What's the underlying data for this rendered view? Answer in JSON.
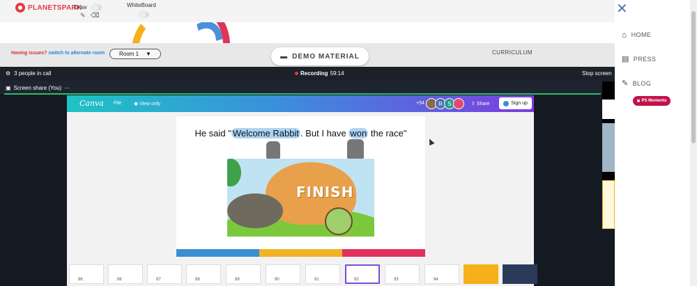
{
  "topbar": {
    "logo": "PLANETSPARK",
    "draw_label": "Draw",
    "whiteboard_label": "WhiteBoard"
  },
  "nav": {
    "close_icon": "close-icon",
    "items": [
      {
        "label": "HOME",
        "icon": "home-icon"
      },
      {
        "label": "PRESS",
        "icon": "press-icon"
      },
      {
        "label": "BLOG",
        "icon": "blog-icon"
      }
    ],
    "ps_badge": "PS Moments"
  },
  "issues": {
    "prefix": "Having issues?",
    "link": "switch to alternate room",
    "room": "Room 1"
  },
  "demo_material": "DEMO MATERIAL",
  "curriculum": "CURRICULUM",
  "call": {
    "people": "3 people in call",
    "recording_label": "Recording",
    "recording_time": "59:14",
    "stop_screen": "Stop screen",
    "share_tab": "Screen share (You)"
  },
  "canva": {
    "logo": "Canva",
    "file": "File",
    "view_only": "View only",
    "participants_count": "+54",
    "avatars": [
      "R",
      "S"
    ],
    "share": "Share",
    "signup": "Sign up",
    "slide": {
      "text_before": "He said \"",
      "highlight1": "Welcome Rabbit",
      "text_middle": ". But I have ",
      "highlight2": "won",
      "text_after": " the race\"",
      "image_caption": "FINISH"
    },
    "thumbnails": [
      "86",
      "86",
      "87",
      "88",
      "89",
      "90",
      "91",
      "92",
      "93",
      "94"
    ],
    "selected_thumbnail": "92"
  },
  "colors": {
    "canva_gradient_start": "#1fc3c4",
    "canva_gradient_end": "#7d3ce0",
    "slide_bar": [
      "#3b8fd0",
      "#f0b324",
      "#e0335a"
    ],
    "recording": "#e53935",
    "ps_badge": "#c2124a"
  }
}
